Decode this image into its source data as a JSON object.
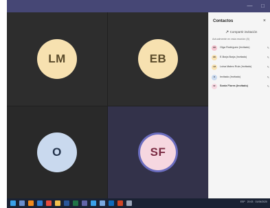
{
  "window": {
    "controls": {
      "minimize": "—",
      "maximize": "□"
    }
  },
  "tiles": [
    {
      "initials": "LM",
      "color": "#f7e1b0"
    },
    {
      "initials": "EB",
      "color": "#f7e1b0"
    },
    {
      "initials": "O",
      "color": "#c9d9ee"
    },
    {
      "initials": "SF",
      "color": "#f6d7e0",
      "speaking": true
    }
  ],
  "panel": {
    "title": "Contactos",
    "close": "×",
    "share_label": "Compartir invitación",
    "share_icon": "share-icon",
    "section_label": "Actualmente en esta reunión (5)",
    "people": [
      {
        "initials": "OR",
        "name": "Olga Rodríguez (Invitado)",
        "color": "#f4c4cf"
      },
      {
        "initials": "EB",
        "name": "E.Borja Borja (Invitado)",
        "color": "#f7e1b0"
      },
      {
        "initials": "LM",
        "name": "Luisa Mateo Ruiz (Invitado)",
        "color": "#f7e1b0"
      },
      {
        "initials": "O",
        "name": "Invitado (Invitado)",
        "color": "#c9d9ee"
      },
      {
        "initials": "SF",
        "name": "Sonia Flores (Invitado)",
        "color": "#f6d7e0"
      }
    ]
  },
  "taskbar": {
    "icons": [
      "windows-icon",
      "task-view-icon",
      "vlc-icon",
      "edge-icon",
      "chrome-icon",
      "explorer-icon",
      "word-icon",
      "excel-icon",
      "teams-icon",
      "photos-icon",
      "store-icon",
      "outlook-icon",
      "powerpoint-icon",
      "settings-icon"
    ],
    "icon_colors": [
      "#3aa0e8",
      "#6a8fcf",
      "#f08a1c",
      "#2d7dd2",
      "#e84c3d",
      "#f2c14e",
      "#2b579a",
      "#217346",
      "#6264a7",
      "#3aa0e8",
      "#7aa9e0",
      "#0f6cbd",
      "#d24726",
      "#9aa5b8"
    ],
    "tray": {
      "lang": "ESP",
      "time": "20:03",
      "date": "01/06/2020"
    }
  }
}
